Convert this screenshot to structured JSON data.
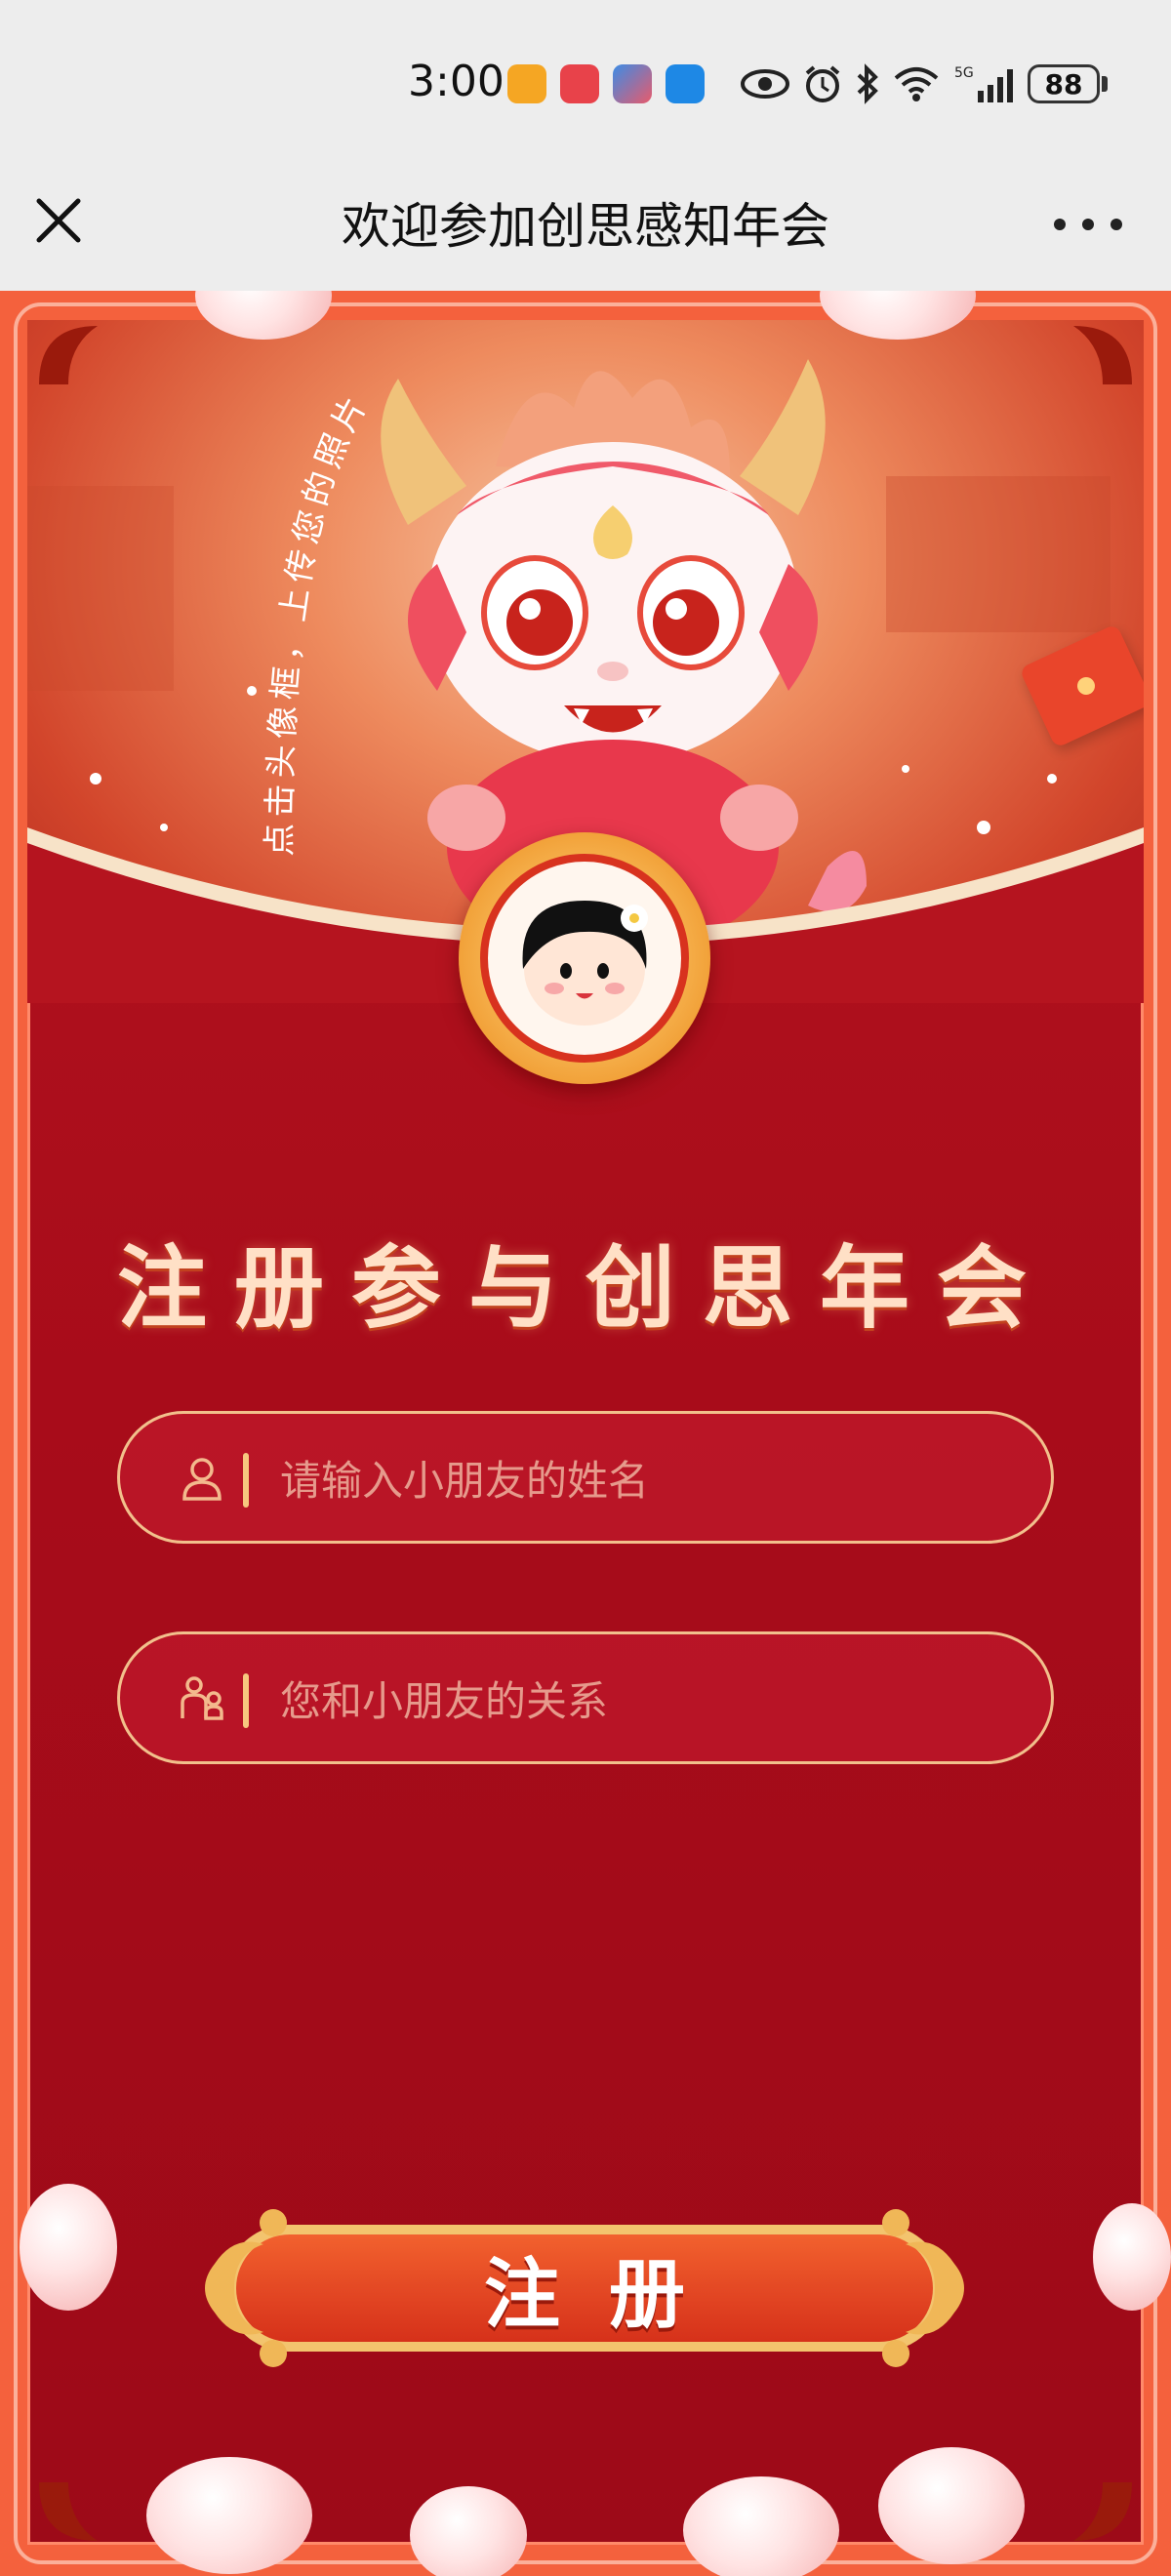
{
  "status_bar": {
    "time": "3:00",
    "app_icons": [
      {
        "name": "app-icon-orange",
        "color": "#f5a623"
      },
      {
        "name": "app-icon-huawei",
        "color": "#e8424a"
      },
      {
        "name": "app-icon-game",
        "color": "#3c8ce6"
      },
      {
        "name": "app-icon-blue",
        "color": "#1e88e5"
      }
    ],
    "network": "5G",
    "battery": "88",
    "icons": [
      "eye-icon",
      "alarm-icon",
      "bluetooth-icon",
      "wifi-icon",
      "signal-icon",
      "battery-icon"
    ]
  },
  "nav": {
    "title": "欢迎参加创思感知年会",
    "close_icon": "close-icon",
    "more_icon": "more-icon"
  },
  "hero": {
    "curved_hint": "点击头像框，上传您的照片",
    "avatar_icon": "cartoon-girl-avatar"
  },
  "form": {
    "title": "注册参与创思年会",
    "name_placeholder": "请输入小朋友的姓名",
    "name_icon": "user-icon",
    "relation_placeholder": "您和小朋友的关系",
    "relation_icon": "family-icon",
    "submit_label": "注册"
  },
  "theme": {
    "primary_red": "#a80c1a",
    "accent_orange": "#f4613d",
    "gold": "#f2c08c"
  }
}
